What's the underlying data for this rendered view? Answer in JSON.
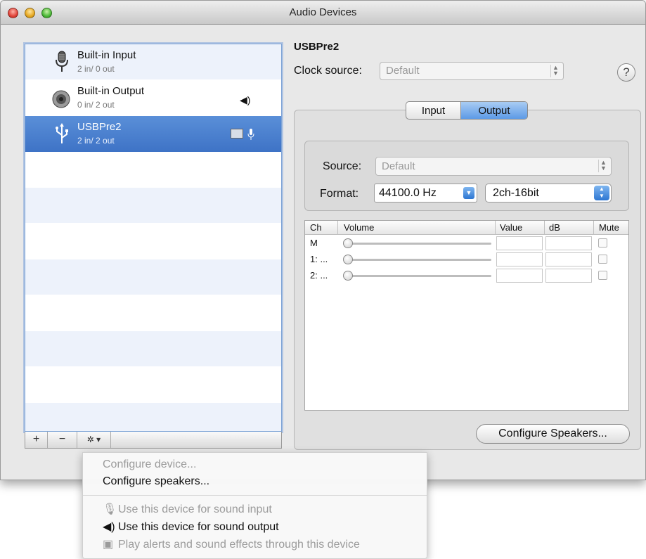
{
  "window": {
    "title": "Audio Devices"
  },
  "devices": [
    {
      "name": "Built-in Input",
      "io": "2 in/ 0 out",
      "icon": "microphone-icon",
      "badges": []
    },
    {
      "name": "Built-in Output",
      "io": "0 in/ 2 out",
      "icon": "speaker-icon",
      "badges": [
        "speaker-output-icon"
      ]
    },
    {
      "name": "USBPre2",
      "io": "2 in/ 2 out",
      "icon": "usb-icon",
      "badges": [
        "alert-sound-icon",
        "microphone-input-icon"
      ],
      "selected": true
    }
  ],
  "list_buttons": {
    "add": "+",
    "remove": "−",
    "action": "✲ ▾"
  },
  "detail": {
    "device_name": "USBPre2",
    "clock_label": "Clock source:",
    "clock_value": "Default",
    "help": "?",
    "tabs": [
      "Input",
      "Output"
    ],
    "active_tab": "Output",
    "source_label": "Source:",
    "source_value": "Default",
    "format_label": "Format:",
    "format_rate": "44100.0 Hz",
    "format_bits": "2ch-16bit",
    "columns": [
      "Ch",
      "Volume",
      "Value",
      "dB",
      "Mute"
    ],
    "channels": [
      {
        "ch": "M",
        "volume": 0,
        "mute": false
      },
      {
        "ch": "1: ...",
        "volume": 0,
        "mute": false
      },
      {
        "ch": "2: ...",
        "volume": 0,
        "mute": false
      }
    ],
    "configure_speakers": "Configure Speakers..."
  },
  "menu": {
    "items": [
      {
        "label": "Configure device...",
        "enabled": false
      },
      {
        "label": "Configure speakers...",
        "enabled": true
      }
    ],
    "items2": [
      {
        "label": "Use this device for sound input",
        "icon": "microphone-icon",
        "enabled": false
      },
      {
        "label": "Use this device for sound output",
        "icon": "speaker-icon",
        "enabled": true
      },
      {
        "label": "Play alerts and sound effects through this device",
        "icon": "alert-sound-icon",
        "enabled": false
      }
    ]
  }
}
